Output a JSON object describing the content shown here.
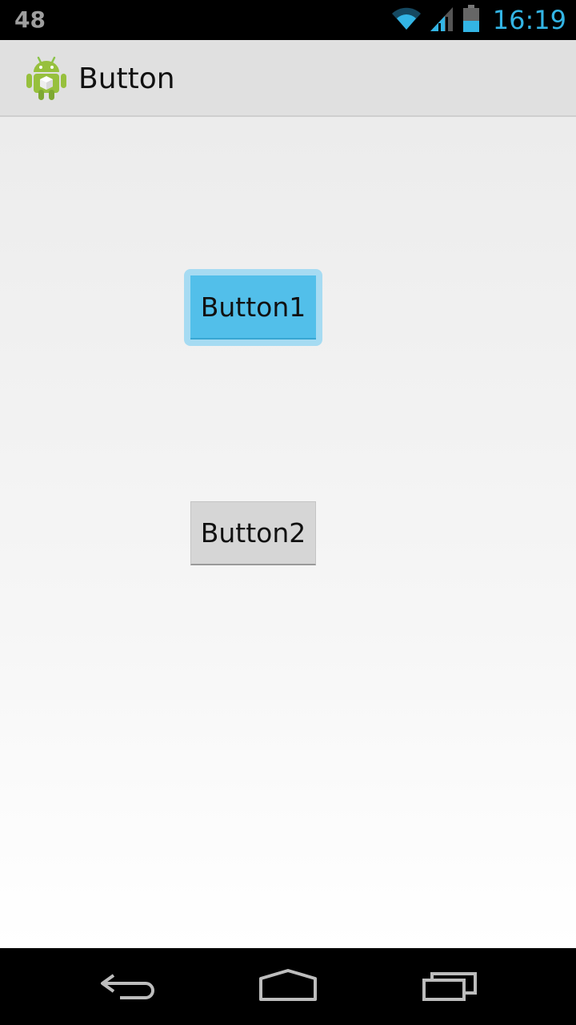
{
  "status_bar": {
    "left_text": "48",
    "time": "16:19",
    "icons": [
      "wifi-icon",
      "signal-icon",
      "battery-icon"
    ]
  },
  "action_bar": {
    "app_icon": "android-app-icon",
    "title": "Button"
  },
  "buttons": {
    "button1_label": "Button1",
    "button2_label": "Button2"
  },
  "nav_bar": {
    "icons": [
      "back-icon",
      "home-icon",
      "recents-icon"
    ]
  },
  "colors": {
    "accent": "#33b5e5",
    "focused_button": "#52bfea",
    "focus_ring": "#a6dbf2",
    "default_button": "#d6d6d6"
  }
}
